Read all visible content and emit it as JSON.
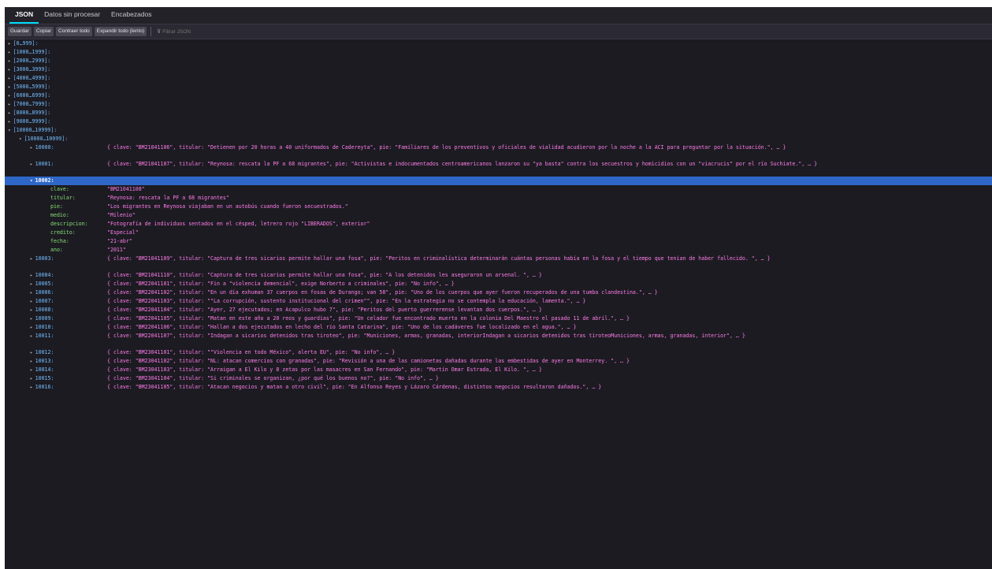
{
  "tabs": [
    {
      "label": "JSON",
      "active": true
    },
    {
      "label": "Datos sin procesar",
      "active": false
    },
    {
      "label": "Encabezados",
      "active": false
    }
  ],
  "toolbar": {
    "save": "Guardar",
    "copy": "Copiar",
    "collapse_all": "Contraer todo",
    "expand_all": "Expandir todo (lento)",
    "filter_placeholder": "Filtrar JSON"
  },
  "ranges": [
    "[0…999]:",
    "[1000…1999]:",
    "[2000…2999]:",
    "[3000…3999]:",
    "[4000…4999]:",
    "[5000…5999]:",
    "[6000…6999]:",
    "[7000…7999]:",
    "[8000…8999]:",
    "[9000…9999]:"
  ],
  "open_range": "[10000…10999]:",
  "open_subrange": "[10000…10099]:",
  "rows_before": [
    {
      "key": "10000:",
      "val": "{ clave: \"BM21041106\", titular: \"Detienen por 20 horas a 40 uniformados de Cadereyta\", pie: \"Familiares de los preventivos y oficiales de vialidad acudieron por la noche a la ACI para preguntar por la situación.\", … }"
    },
    {
      "key": "10001:",
      "val": "{ clave: \"BM21041107\", titular: \"Reynosa: rescata la PF a 68 migrantes\", pie: \"Activistas e indocumentados centroamericanos lanzaron su \"ya basta\" contra los secuestros y homicidios con un \"viacrucis\" por el río Suchiate.\", … }"
    }
  ],
  "selected": {
    "key": "10002:",
    "props": [
      {
        "name": "clave:",
        "value": "\"BM21041108\""
      },
      {
        "name": "titular:",
        "value": "\"Reynosa: rescata la PF a 68 migrantes\""
      },
      {
        "name": "pie:",
        "value": "\"Los migrantes en Reynosa viajaban en un autobús cuando fueron secuestrados.\""
      },
      {
        "name": "medio:",
        "value": "\"Milenio\""
      },
      {
        "name": "descripcion:",
        "value": "\"Fotografía de individuos sentados en el césped, letrero rojo \"LIBERADOS\", exterior\""
      },
      {
        "name": "credito:",
        "value": "\"Especial\""
      },
      {
        "name": "fecha:",
        "value": "\"21-abr\""
      },
      {
        "name": "ano:",
        "value": "\"2011\""
      }
    ]
  },
  "rows_after": [
    {
      "key": "10003:",
      "val": "{ clave: \"BM21041109\", titular: \"Captura de tres sicarios permite hallar una fosa\", pie: \"Peritos en criminalística determinarán cuántas personas había en la fosa y el tiempo que tenían de haber fallecido. \", … }",
      "tall": true
    },
    {
      "key": "10004:",
      "val": "{ clave: \"BM21041110\", titular: \"Captura de tres sicarios permite hallar una fosa\", pie: \"A los detenidos les aseguraron un arsenal. \", … }"
    },
    {
      "key": "10005:",
      "val": "{ clave: \"BM22041101\", titular: \"Fin a \"violencia demencial\", exige Norberto a criminales\", pie: \"No info\", … }"
    },
    {
      "key": "10006:",
      "val": "{ clave: \"BM22041102\", titular: \"En un día exhuman 37 cuerpos en fosas de Durango; van 58\", pie: \"Uno de los cuerpos que ayer fueron recuperados de una tumba clandestina.\", … }"
    },
    {
      "key": "10007:",
      "val": "{ clave: \"BM22041103\", titular: \"\"La corrupción, sustento institucional del crimen\"\", pie: \"En la estrategia no se contempla la educación, lamenta.\", … }"
    },
    {
      "key": "10008:",
      "val": "{ clave: \"BM22041104\", titular: \"Ayer, 27 ejecutados; en Acapulco hubo 7\", pie: \"Peritos del puerto guerrerense levantan dos cuerpos.\", … }"
    },
    {
      "key": "10009:",
      "val": "{ clave: \"BM22041105\", titular: \"Matan en este año a 20 reos y guardias\", pie: \"Un celador fue encontrado muerto en la colonia Del Maestro el pasado 11 de abril.\", … }"
    },
    {
      "key": "10010:",
      "val": "{ clave: \"BM22041106\", titular: \"Hallan a dos ejecutados en lecho del río Santa Catarina\", pie: \"Uno de los cadáveres fue localizado en el agua.\", … }"
    },
    {
      "key": "10011:",
      "val": "{ clave: \"BM22041107\", titular: \"Indagan a sicarios detenidos tras tiroteo\", pie: \"Municiones, armas, granadas, interiorIndagan a sicarios detenidos tras tiroteoMuniciones, armas, granadas, interior\", … }",
      "tall": true
    },
    {
      "key": "10012:",
      "val": "{ clave: \"BM23041101\", titular: \"\"Violencia en todo México\", alerta EU\", pie: \"No info\", … }"
    },
    {
      "key": "10013:",
      "val": "{ clave: \"BM23041102\", titular: \"NL: atacan comercios con granadas\", pie: \"Revisión a una de las camionetas dañadas durante las embestidas de ayer en Monterrey. \", … }"
    },
    {
      "key": "10014:",
      "val": "{ clave: \"BM23041103\", titular: \"Arraigan a El Kilo y 8 zetas por las masacres en San Fernando\", pie: \"Martín Omar Estrada, El Kilo. \", … }"
    },
    {
      "key": "10015:",
      "val": "{ clave: \"BM23041104\", titular: \"Si criminales se organizan, ¿por qué los buenos no?\", pie: \"No info\", … }"
    },
    {
      "key": "10016:",
      "val": "{ clave: \"BM23041105\", titular: \"Atacan negocios y matan a otro civil\", pie: \"En Alfonso Reyes y Lázaro Cárdenas, distintos negocios resultaron dañados.\", … }"
    }
  ]
}
